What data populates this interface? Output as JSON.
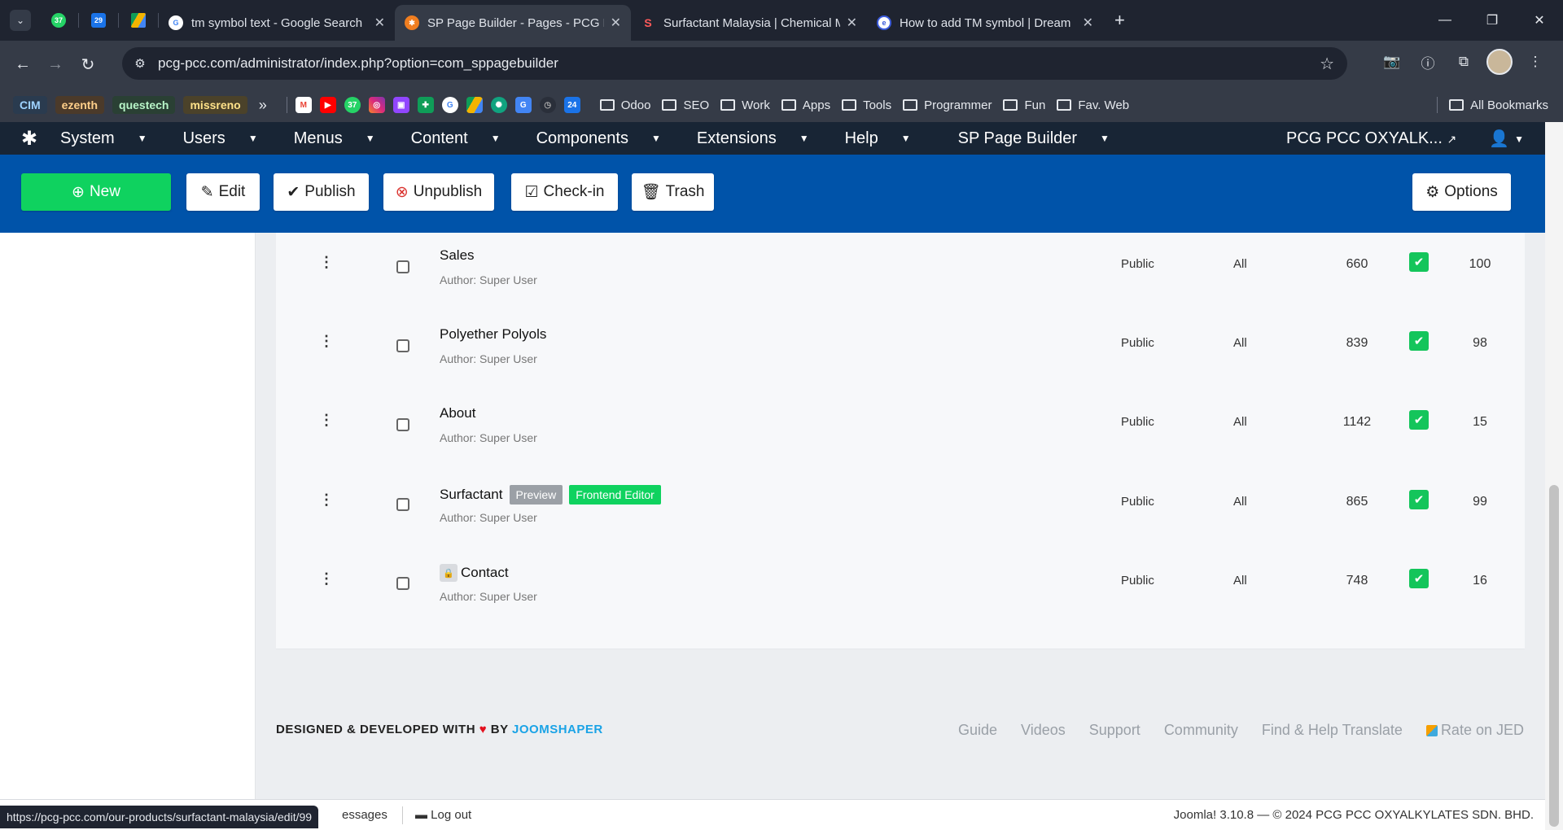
{
  "browser": {
    "pinned_badges": [
      "37",
      "29"
    ],
    "tabs": [
      {
        "title": "tm symbol text - Google Search",
        "active": false
      },
      {
        "title": "SP Page Builder - Pages - PCG P",
        "active": true
      },
      {
        "title": "Surfactant Malaysia | Chemical M",
        "active": false
      },
      {
        "title": "How to add TM symbol | Dream",
        "active": false
      }
    ],
    "url": "pcg-pcc.com/administrator/index.php?option=com_sppagebuilder",
    "bookmark_chips": [
      {
        "label": "CIM",
        "bg": "#2a3b4f",
        "fg": "#9fd3ff"
      },
      {
        "label": "ezenth",
        "bg": "#4b3a2a",
        "fg": "#ffcf8a"
      },
      {
        "label": "questech",
        "bg": "#2a4034",
        "fg": "#b8f5c8"
      },
      {
        "label": "missreno",
        "bg": "#4b422a",
        "fg": "#ffe28a"
      }
    ],
    "bookmark_badge": "37",
    "bookmark_folders": [
      "Odoo",
      "SEO",
      "Work",
      "Apps",
      "Tools",
      "Programmer",
      "Fun",
      "Fav. Web"
    ],
    "all_bookmarks": "All Bookmarks",
    "more": "»"
  },
  "joomla": {
    "menu": [
      "System",
      "Users",
      "Menus",
      "Content",
      "Components",
      "Extensions",
      "Help",
      "SP Page Builder"
    ],
    "site_name": "PCG PCC OXYALK...",
    "toolbar": {
      "new": "New",
      "edit": "Edit",
      "publish": "Publish",
      "unpublish": "Unpublish",
      "checkin": "Check-in",
      "trash": "Trash",
      "options": "Options"
    }
  },
  "pages": [
    {
      "title": "Sales",
      "author": "Author: Super User",
      "access": "Public",
      "language": "All",
      "hits": "660",
      "id": "100"
    },
    {
      "title": "Polyether Polyols",
      "author": "Author: Super User",
      "access": "Public",
      "language": "All",
      "hits": "839",
      "id": "98"
    },
    {
      "title": "About",
      "author": "Author: Super User",
      "access": "Public",
      "language": "All",
      "hits": "1142",
      "id": "15"
    },
    {
      "title": "Surfactant",
      "author": "Author: Super User",
      "access": "Public",
      "language": "All",
      "hits": "865",
      "id": "99",
      "preview_label": "Preview",
      "frontend_label": "Frontend Editor"
    },
    {
      "title": "Contact",
      "author": "Author: Super User",
      "access": "Public",
      "language": "All",
      "hits": "748",
      "id": "16"
    }
  ],
  "footer": {
    "credit_prefix": "DESIGNED & DEVELOPED WITH",
    "credit_by": "BY",
    "credit_brand": "JOOMSHAPER",
    "links": [
      "Guide",
      "Videos",
      "Support",
      "Community",
      "Find & Help Translate",
      "Rate on JED"
    ]
  },
  "statusbar": {
    "messages": "essages",
    "logout": "Log out",
    "copyright": "Joomla! 3.10.8  —  © 2024 PCG PCC OXYALKYLATES SDN. BHD."
  },
  "hover_url": "https://pcg-pcc.com/our-products/surfactant-malaysia/edit/99",
  "colors": {
    "toolbar_blue": "#0053a9",
    "new_green": "#0fd25f",
    "header_navy": "#182535",
    "published_green": "#14c55b",
    "brand_blue": "#1aa3e6"
  }
}
